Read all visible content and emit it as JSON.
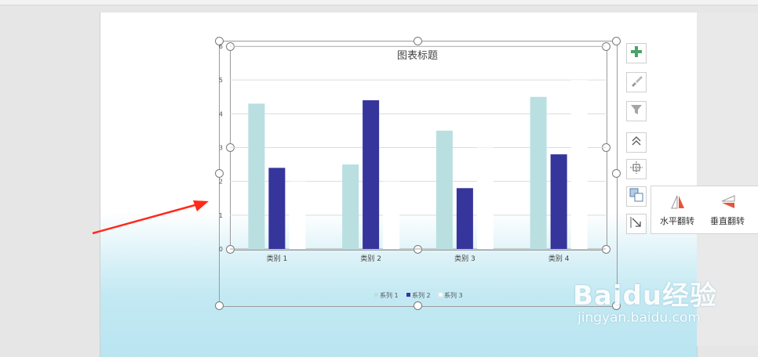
{
  "chart_data": {
    "type": "bar",
    "title": "图表标题",
    "categories": [
      "类别 1",
      "类别 2",
      "类别 3",
      "类别 4"
    ],
    "series": [
      {
        "name": "系列 1",
        "values": [
          4.3,
          2.5,
          3.5,
          4.5
        ],
        "color": "#b9dfe1"
      },
      {
        "name": "系列 2",
        "values": [
          2.4,
          4.4,
          1.8,
          2.8
        ],
        "color": "#35359c"
      },
      {
        "name": "系列 3",
        "values": [
          2.0,
          2.0,
          3.0,
          5.0
        ],
        "color": "#ffffff"
      }
    ],
    "ylim": [
      0,
      6
    ],
    "yticks": [
      "0",
      "1",
      "2",
      "3",
      "4",
      "5",
      "6"
    ],
    "grid": true,
    "legend": "bottom"
  },
  "toolbar": {
    "add_element_icon": "plus-icon",
    "style_icon": "brush-icon",
    "filter_icon": "filter-icon"
  },
  "flip_panel": {
    "horizontal_label": "水平翻转",
    "vertical_label": "垂直翻转"
  },
  "watermark": {
    "brand": "Baidu经验",
    "url": "jingyan.baidu.com"
  },
  "colors": {
    "arrow": "#ff2a1a",
    "plus_icon": "#4aa36b",
    "flip_icon_red": "#e5553b"
  }
}
